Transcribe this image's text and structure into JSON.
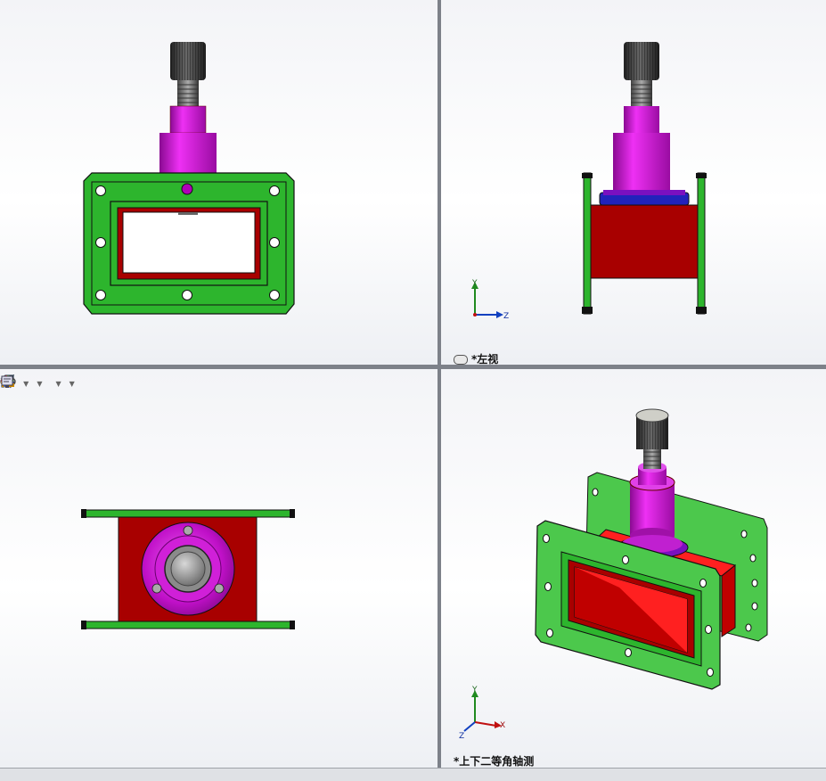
{
  "viewports": {
    "top_left": {
      "label": ""
    },
    "top_right": {
      "label": "*左视"
    },
    "bottom_left": {
      "label": ""
    },
    "bottom_right": {
      "label": "*上下二等角轴测"
    }
  },
  "axis_labels": {
    "y": "Y",
    "z": "Z",
    "x": "X"
  },
  "heads_up_toolbar": [
    {
      "name": "section-view-icon"
    },
    {
      "name": "view-orientation-icon"
    },
    {
      "name": "display-style-icon"
    },
    {
      "name": "hide-show-items-icon"
    },
    {
      "name": "edit-appearance-icon"
    },
    {
      "name": "apply-scene-icon"
    },
    {
      "name": "view-settings-icon"
    }
  ],
  "colors": {
    "flange": "#2db52d",
    "body": "#a80000",
    "body_inner": "#ff1f1f",
    "knob_base": "#c010c8",
    "knob": "#3a3a3a",
    "ring": "#2222bb"
  }
}
